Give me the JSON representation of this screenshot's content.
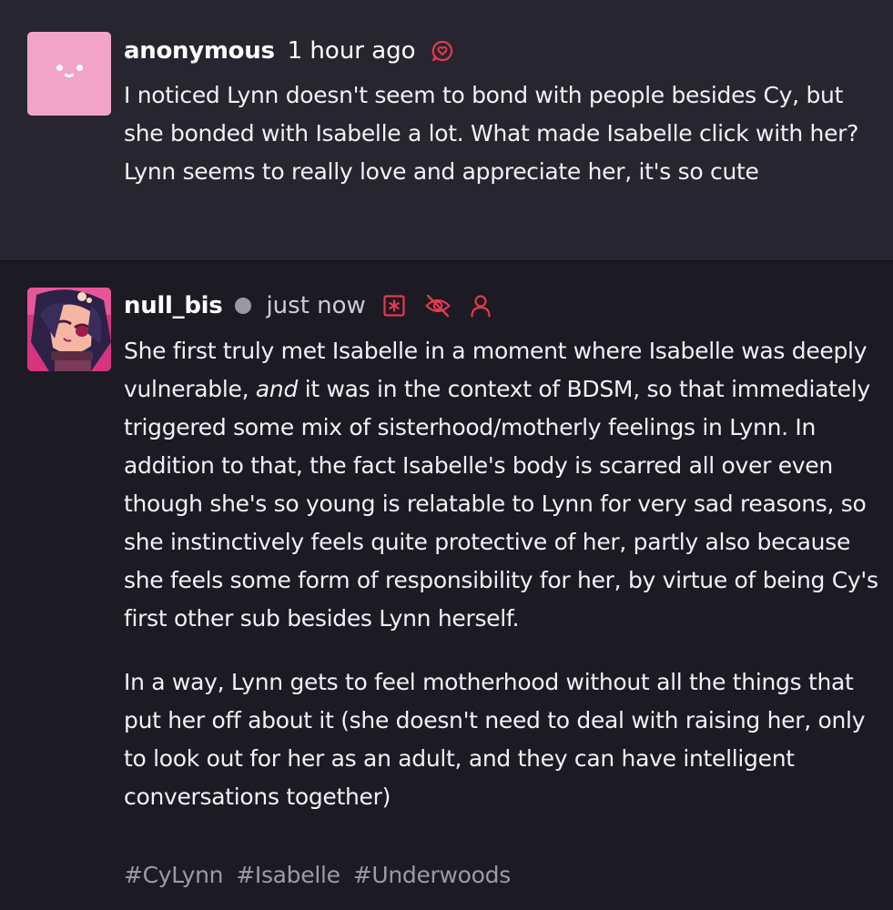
{
  "ask": {
    "username": "anonymous",
    "timestamp": "1 hour ago",
    "icon": "heart-bubble-icon",
    "text": "I noticed Lynn doesn't seem to bond with people besides Cy, but she bonded with Isabelle a lot. What made Isabelle click with her? Lynn seems to really love and appreciate her, it's so cute"
  },
  "reply": {
    "username": "null_bis",
    "timestamp": "just now",
    "icons": [
      "asterisk-box-icon",
      "eye-off-icon",
      "user-icon"
    ],
    "paragraphs": [
      {
        "before": "She first truly met Isabelle in a moment where Isabelle was deeply vulnerable, ",
        "emphasis": "and",
        "after": " it was in the context of BDSM, so that immediately triggered some mix of sisterhood/motherly feelings in Lynn. In addition to that, the fact Isabelle's body is scarred all over even though she's so young is relatable to Lynn for very sad reasons, so she instinctively feels quite protective of her, partly also because she feels some form of responsibility for her, by virtue of being Cy's first other sub besides Lynn herself."
      },
      {
        "text": "In a way, Lynn gets to feel motherhood without all the things that put her off about it (she doesn't need to deal with raising her, only to look out for her as an adult, and they can have intelligent conversations together)"
      }
    ],
    "tags": [
      "#CyLynn",
      "#Isabelle",
      "#Underwoods"
    ]
  },
  "colors": {
    "accent": "#e5384f",
    "ask_background": "#272530",
    "reply_background": "#1c1b24",
    "anon_avatar": "#f2a4c6",
    "tag_text": "#9d99a6"
  }
}
